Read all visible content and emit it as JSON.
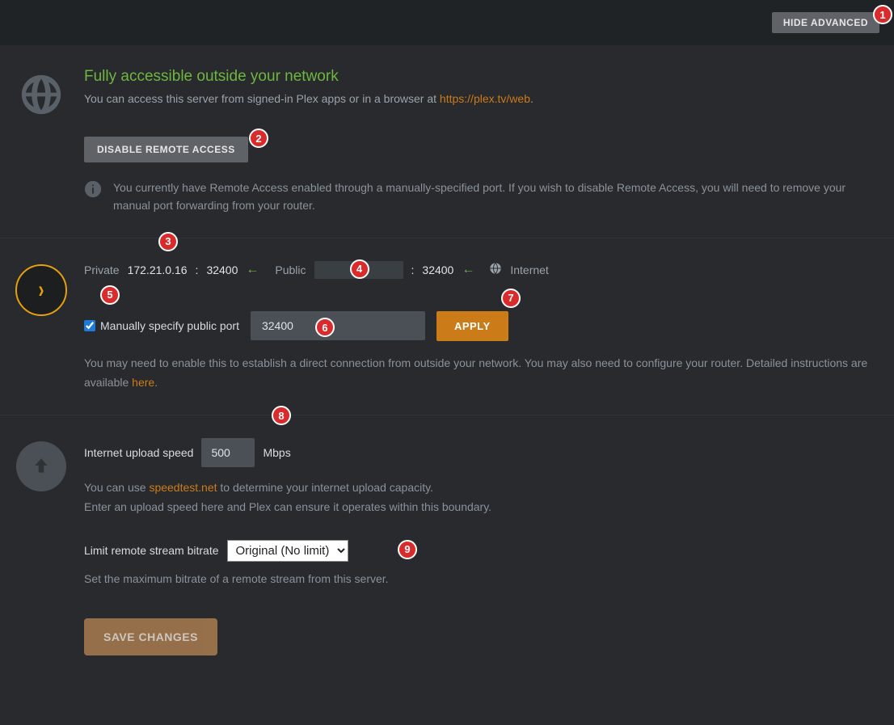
{
  "header": {
    "hideAdvanced": "HIDE ADVANCED"
  },
  "status": {
    "title": "Fully accessible outside your network",
    "descPrefix": "You can access this server from signed-in Plex apps or in a browser at ",
    "descLink": "https://plex.tv/web",
    "descSuffix": "."
  },
  "disable": {
    "button": "DISABLE REMOTE ACCESS",
    "warn": "You currently have Remote Access enabled through a manually-specified port. If you wish to disable Remote Access, you will need to remove your manual port forwarding from your router."
  },
  "network": {
    "privateLabel": "Private",
    "privateIp": "172.21.0.16",
    "privatePort": "32400",
    "publicLabel": "Public",
    "publicPort": "32400",
    "internetLabel": "Internet"
  },
  "port": {
    "checkboxLabel": "Manually specify public port",
    "value": "32400",
    "apply": "APPLY",
    "help1": "You may need to enable this to establish a direct connection from outside your network. You may also need to configure your router. Detailed instructions are available ",
    "helpLink": "here",
    "help2": "."
  },
  "upload": {
    "label": "Internet upload speed",
    "value": "500",
    "unit": "Mbps",
    "help1": "You can use ",
    "helpLink": "speedtest.net",
    "help2": " to determine your internet upload capacity.",
    "help3": "Enter an upload speed here and Plex can ensure it operates within this boundary."
  },
  "bitrate": {
    "label": "Limit remote stream bitrate",
    "selected": "Original (No limit)",
    "help": "Set the maximum bitrate of a remote stream from this server."
  },
  "save": "SAVE CHANGES",
  "badges": {
    "b1": "1",
    "b2": "2",
    "b3": "3",
    "b4": "4",
    "b5": "5",
    "b6": "6",
    "b7": "7",
    "b8": "8",
    "b9": "9"
  }
}
